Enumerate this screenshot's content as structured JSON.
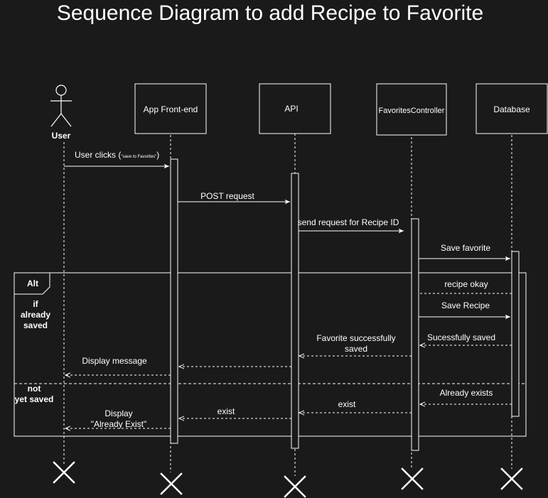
{
  "title": "Sequence Diagram to add Recipe to Favorite",
  "participants": {
    "user": "User",
    "frontend": "App Front-end",
    "api": "API",
    "controller": "FavoritesController",
    "database": "Database"
  },
  "fragment": {
    "label": "Alt",
    "guard1": [
      "if",
      "already",
      "saved"
    ],
    "guard2": [
      "not",
      "yet saved"
    ]
  },
  "messages": {
    "user_clicks": "User clicks (",
    "user_clicks_small": "\"save to Favorites\"",
    "user_clicks_end": ")",
    "post_request": "POST request",
    "send_request": "send request for Recipe ID",
    "save_favorite": "Save favorite",
    "recipe_okay": "recipe okay",
    "save_recipe": "Save Recipe",
    "successfully_saved": "Sucessfully saved",
    "favorite_success": [
      "Favorite successfully",
      "saved"
    ],
    "display_message": "Display message",
    "already_exists": "Already exists",
    "exist_api": "exist",
    "exist_fe": "exist",
    "display_already": [
      "Display",
      "\"Already Exist\""
    ]
  },
  "colors": {
    "background": "#1a1a1a",
    "stroke": "#ffffff"
  }
}
